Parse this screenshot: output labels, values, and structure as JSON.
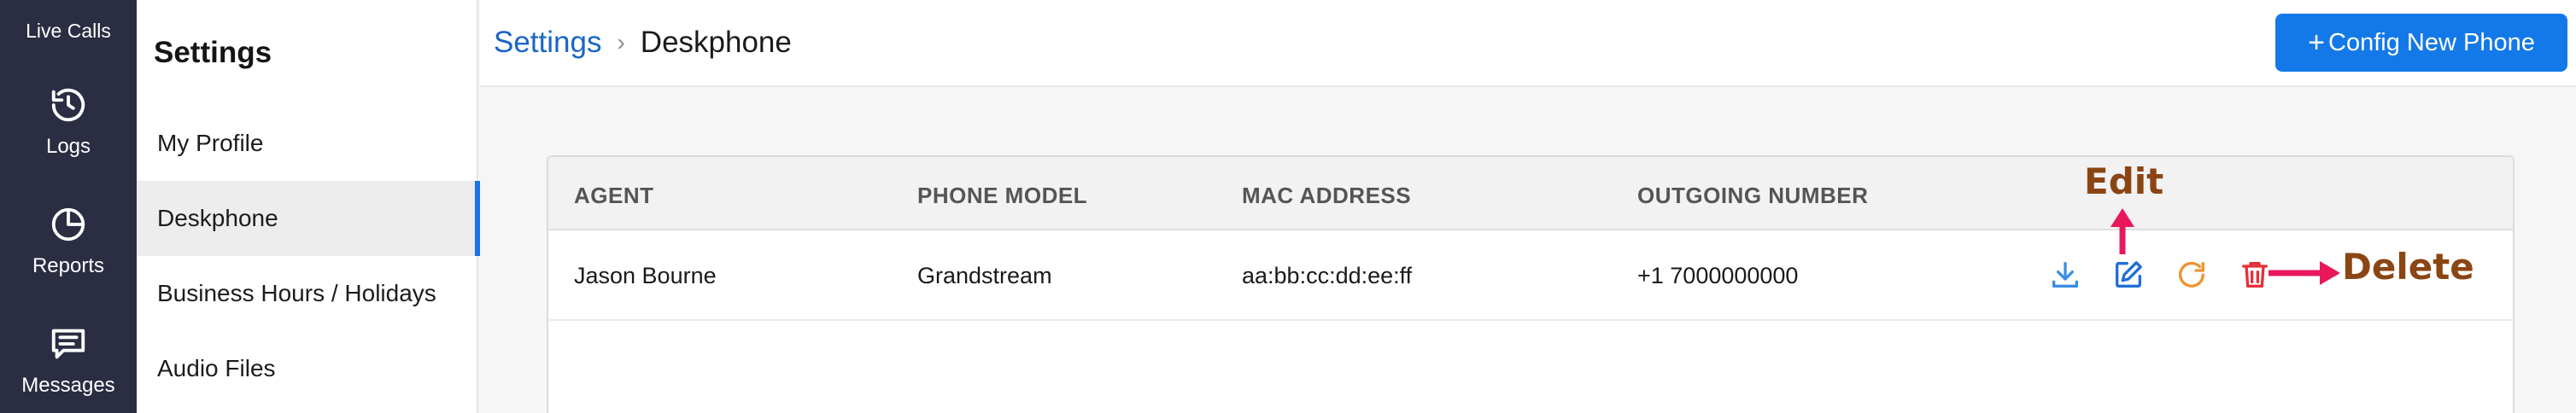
{
  "rail": {
    "live_calls": "Live Calls",
    "items": [
      {
        "label": "Logs",
        "icon": "history-icon"
      },
      {
        "label": "Reports",
        "icon": "pie-chart-icon"
      },
      {
        "label": "Messages",
        "icon": "message-icon"
      }
    ]
  },
  "sidebar": {
    "title": "Settings",
    "items": [
      {
        "label": "My Profile"
      },
      {
        "label": "Deskphone",
        "active": true
      },
      {
        "label": "Business Hours / Holidays"
      },
      {
        "label": "Audio Files"
      }
    ]
  },
  "header": {
    "breadcrumb_parent": "Settings",
    "breadcrumb_separator": "›",
    "breadcrumb_current": "Deskphone",
    "config_button": "Config New Phone",
    "config_button_plus": "+"
  },
  "table": {
    "columns": [
      "AGENT",
      "PHONE MODEL",
      "MAC ADDRESS",
      "OUTGOING NUMBER"
    ],
    "rows": [
      {
        "agent": "Jason Bourne",
        "phone_model": "Grandstream",
        "mac_address": "aa:bb:cc:dd:ee:ff",
        "outgoing_number": "+1 7000000000"
      }
    ],
    "actions": [
      {
        "icon": "download-icon",
        "color": "#3b8fe0"
      },
      {
        "icon": "edit-icon",
        "color": "#1f6fd6"
      },
      {
        "icon": "refresh-icon",
        "color": "#f0922e"
      },
      {
        "icon": "trash-icon",
        "color": "#e5303b"
      }
    ]
  },
  "annotations": {
    "edit": "Edit",
    "delete": "Delete",
    "text_color": "#8b4513",
    "arrow_color": "#e8185b"
  },
  "colors": {
    "accent": "#1479e8",
    "rail_bg": "#2b2d42"
  }
}
